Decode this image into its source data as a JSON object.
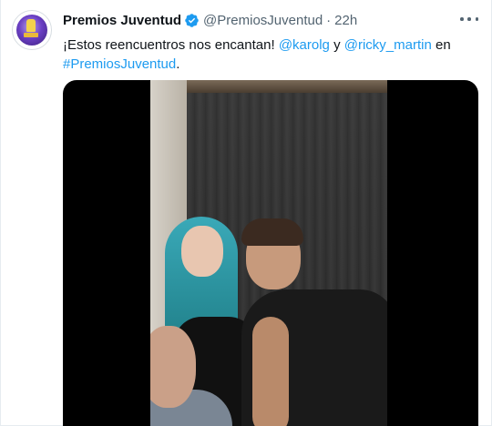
{
  "tweet": {
    "display_name": "Premios Juventud",
    "handle": "@PremiosJuventud",
    "separator": "·",
    "time": "22h",
    "text_before": "¡Estos reencuentros nos encantan! ",
    "mention1": "@karolg",
    "text_mid": " y ",
    "mention2": "@ricky_martin",
    "text_after": " en",
    "hashtag": "#PremiosJuventud",
    "text_end": "."
  },
  "icons": {
    "verified": "verified-badge-icon",
    "more": "more-options-icon"
  },
  "colors": {
    "link": "#1d9bf0",
    "verified": "#1d9bf0",
    "secondary_text": "#536471"
  }
}
